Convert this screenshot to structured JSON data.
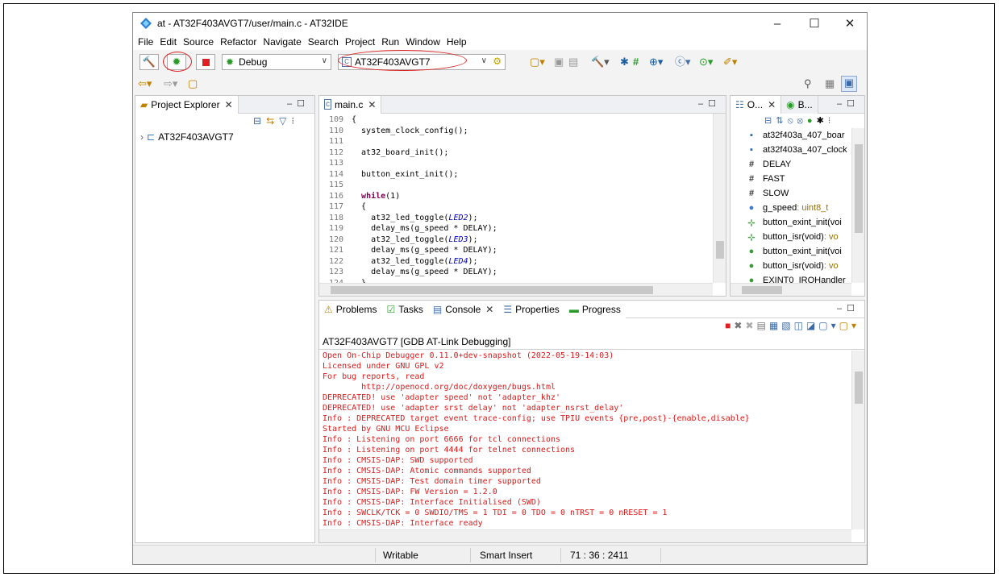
{
  "window": {
    "title": "at - AT32F403AVGT7/user/main.c - AT32IDE",
    "minimize": "–",
    "maximize": "☐",
    "close": "✕"
  },
  "menu": [
    "File",
    "Edit",
    "Source",
    "Refactor",
    "Navigate",
    "Search",
    "Project",
    "Run",
    "Window",
    "Help"
  ],
  "toolbar": {
    "launch_mode": "Debug",
    "launch_target": "AT32F403AVGT7"
  },
  "project_explorer": {
    "tab_label": "Project Explorer",
    "project_name": "AT32F403AVGT7"
  },
  "editor": {
    "tab_label": "main.c",
    "lines": [
      {
        "n": "109",
        "t": "{"
      },
      {
        "n": "110",
        "t": "  system_clock_config();"
      },
      {
        "n": "111",
        "t": ""
      },
      {
        "n": "112",
        "t": "  at32_board_init();"
      },
      {
        "n": "113",
        "t": ""
      },
      {
        "n": "114",
        "t": "  button_exint_init();"
      },
      {
        "n": "115",
        "t": ""
      },
      {
        "n": "116",
        "t": "  while(1)"
      },
      {
        "n": "117",
        "t": "  {"
      },
      {
        "n": "118",
        "t": "    at32_led_toggle(LED2);"
      },
      {
        "n": "119",
        "t": "    delay_ms(g_speed * DELAY);"
      },
      {
        "n": "120",
        "t": "    at32_led_toggle(LED3);"
      },
      {
        "n": "121",
        "t": "    delay_ms(g_speed * DELAY);"
      },
      {
        "n": "122",
        "t": "    at32_led_toggle(LED4);"
      },
      {
        "n": "123",
        "t": "    delay_ms(g_speed * DELAY);"
      },
      {
        "n": "124",
        "t": "  }"
      }
    ]
  },
  "outline": {
    "tab1_label": "O...",
    "tab2_label": "B...",
    "items": [
      {
        "icon": "include-icon",
        "glyph": "▪",
        "color": "#2a6aa8",
        "label": "at32f403a_407_boar",
        "type": ""
      },
      {
        "icon": "include-icon",
        "glyph": "▪",
        "color": "#2a6aa8",
        "label": "at32f403a_407_clock",
        "type": ""
      },
      {
        "icon": "macro-icon",
        "glyph": "#",
        "color": "#333333",
        "label": "DELAY",
        "type": ""
      },
      {
        "icon": "macro-icon",
        "glyph": "#",
        "color": "#333333",
        "label": "FAST",
        "type": ""
      },
      {
        "icon": "macro-icon",
        "glyph": "#",
        "color": "#333333",
        "label": "SLOW",
        "type": ""
      },
      {
        "icon": "variable-icon",
        "glyph": "●",
        "color": "#3b7dc9",
        "label": "g_speed",
        "type": " : uint8_t"
      },
      {
        "icon": "function-decl-icon",
        "glyph": "⊹",
        "color": "#3a9a3a",
        "label": "button_exint_init(voi",
        "type": ""
      },
      {
        "icon": "function-decl-icon",
        "glyph": "⊹",
        "color": "#3a9a3a",
        "label": "button_isr(void)",
        "type": " : vo"
      },
      {
        "icon": "function-icon",
        "glyph": "●",
        "color": "#3a9a3a",
        "label": "button_exint_init(voi",
        "type": ""
      },
      {
        "icon": "function-icon",
        "glyph": "●",
        "color": "#3a9a3a",
        "label": "button_isr(void)",
        "type": " : vo"
      },
      {
        "icon": "function-icon",
        "glyph": "●",
        "color": "#3a9a3a",
        "label": "EXINT0_IRQHandler",
        "type": ""
      }
    ]
  },
  "bottom_tabs": [
    "Problems",
    "Tasks",
    "Console",
    "Properties",
    "Progress"
  ],
  "console": {
    "header": "AT32F403AVGT7 [GDB AT-Link Debugging]",
    "lines": [
      "Open On-Chip Debugger 0.11.0+dev-snapshot (2022-05-19-14:03)",
      "Licensed under GNU GPL v2",
      "For bug reports, read",
      "        http://openocd.org/doc/doxygen/bugs.html",
      "DEPRECATED! use 'adapter speed' not 'adapter_khz'",
      "DEPRECATED! use 'adapter srst delay' not 'adapter_nsrst_delay'",
      "Info : DEPRECATED target event trace-config; use TPIU events {pre,post}-{enable,disable}",
      "Started by GNU MCU Eclipse",
      "Info : Listening on port 6666 for tcl connections",
      "Info : Listening on port 4444 for telnet connections",
      "Info : CMSIS-DAP: SWD supported",
      "Info : CMSIS-DAP: Atomic commands supported",
      "Info : CMSIS-DAP: Test domain timer supported",
      "Info : CMSIS-DAP: FW Version = 1.2.0",
      "Info : CMSIS-DAP: Interface Initialised (SWD)",
      "Info : SWCLK/TCK = 0 SWDIO/TMS = 1 TDI = 0 TDO = 0 nTRST = 0 nRESET = 1",
      "Info : CMSIS-DAP: Interface ready"
    ]
  },
  "status": {
    "writable": "Writable",
    "insert_mode": "Smart Insert",
    "position": "71 : 36 : 2411"
  },
  "colors": {
    "console_text": "#e01818",
    "keyword": "#7f0055",
    "macro": "#0000c0",
    "annotation_circle": "#d22222"
  }
}
